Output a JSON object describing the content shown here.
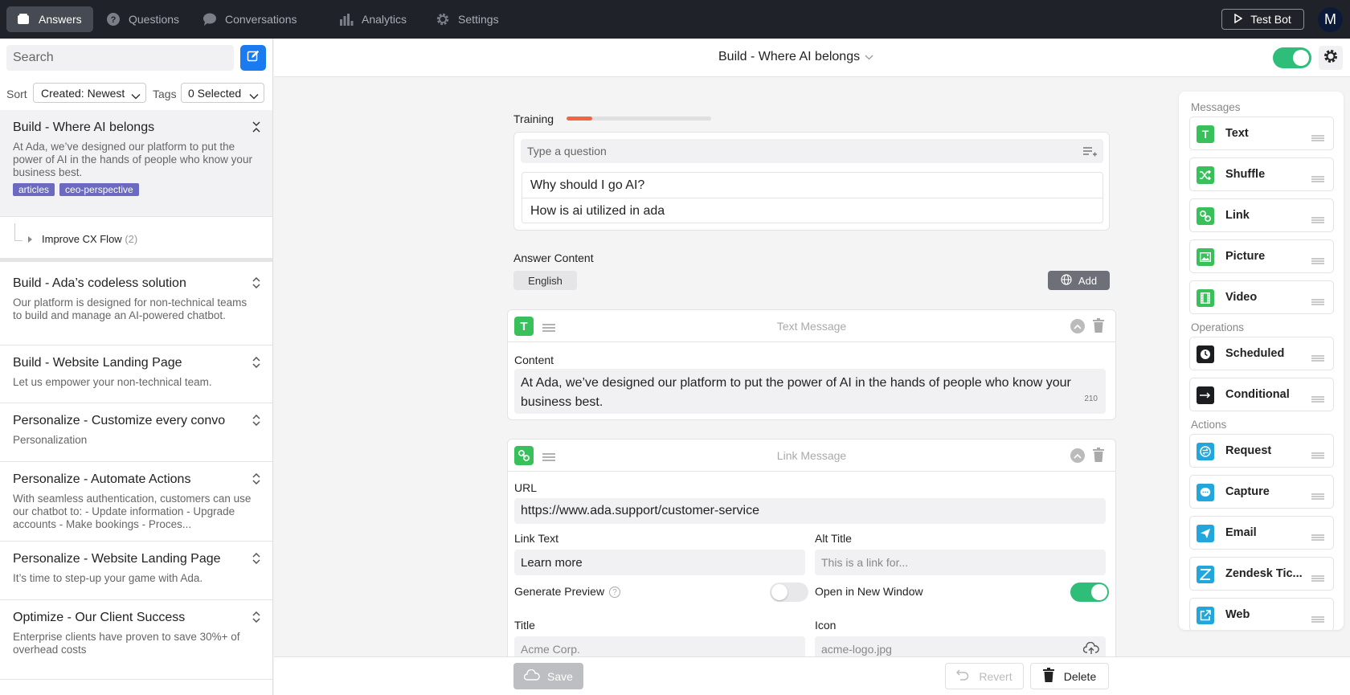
{
  "nav": {
    "tabs": [
      {
        "label": "Answers",
        "icon": "stack-icon",
        "active": true
      },
      {
        "label": "Questions",
        "icon": "question-icon",
        "active": false
      },
      {
        "label": "Conversations",
        "icon": "chat-bubble-icon",
        "active": false
      },
      {
        "label": "Analytics",
        "icon": "bar-chart-icon",
        "active": false
      },
      {
        "label": "Settings",
        "icon": "gear-icon",
        "active": false
      }
    ],
    "test_bot_label": "Test Bot",
    "avatar_initial": "M"
  },
  "sidebar": {
    "search_placeholder": "Search",
    "sort_label": "Sort",
    "sort_value": "Created: Newest",
    "tags_label": "Tags",
    "tags_value": "0 Selected",
    "answers": [
      {
        "title": "Build - Where AI belongs",
        "desc": "At Ada, we’ve designed our platform to put the power of AI in the hands of people who know your business best.",
        "tags": [
          "articles",
          "ceo-perspective"
        ],
        "selected": true
      },
      {
        "title": "Build - Ada’s codeless solution",
        "desc": "Our platform is designed for non-technical teams to build and manage an AI-powered chatbot."
      },
      {
        "title": "Build - Website Landing Page",
        "desc": "Let us empower your non-technical team."
      },
      {
        "title": "Personalize - Customize every convo",
        "desc": "Personalization"
      },
      {
        "title": "Personalize - Automate Actions",
        "desc": "With seamless authentication, customers can use our chatbot to: - Update information - Upgrade accounts - Make bookings - Proces..."
      },
      {
        "title": "Personalize - Website Landing Page",
        "desc": "It’s time to step-up your game with Ada."
      },
      {
        "title": "Optimize - Our Client Success",
        "desc": "Enterprise clients have proven to save 30%+ of overhead costs"
      }
    ],
    "subflow": {
      "label": "Improve CX Flow",
      "count": "(2)"
    }
  },
  "editor": {
    "title": "Build - Where AI belongs",
    "enabled": true,
    "training_label": "Training",
    "training_progress": 0.18,
    "question_placeholder": "Type a question",
    "questions": [
      "Why should I go AI?",
      "How is ai utilized in ada"
    ],
    "answer_content_label": "Answer Content",
    "language": "English",
    "add_label": "Add",
    "text_block": {
      "title": "Text Message",
      "content_label": "Content",
      "content": "At Ada, we’ve designed our platform to put the power of AI in the hands of people who know your business best.",
      "char_count": "210"
    },
    "link_block": {
      "title": "Link Message",
      "url_label": "URL",
      "url": "https://www.ada.support/customer-service",
      "link_text_label": "Link Text",
      "link_text": "Learn more",
      "alt_title_label": "Alt Title",
      "alt_title_placeholder": "This is a link for...",
      "generate_preview_label": "Generate Preview",
      "generate_preview": false,
      "open_new_window_label": "Open in New Window",
      "open_new_window": true,
      "title_label": "Title",
      "title_placeholder": "Acme Corp.",
      "icon_label": "Icon",
      "icon_placeholder": "acme-logo.jpg"
    },
    "save_label": "Save",
    "revert_label": "Revert",
    "delete_label": "Delete"
  },
  "palette": {
    "sections": [
      {
        "label": "Messages",
        "items": [
          {
            "label": "Text",
            "icon": "text-icon",
            "color": "#38c15a"
          },
          {
            "label": "Shuffle",
            "icon": "shuffle-icon",
            "color": "#38c15a"
          },
          {
            "label": "Link",
            "icon": "link-icon",
            "color": "#38c15a"
          },
          {
            "label": "Picture",
            "icon": "picture-icon",
            "color": "#38c15a"
          },
          {
            "label": "Video",
            "icon": "video-icon",
            "color": "#38c15a"
          }
        ]
      },
      {
        "label": "Operations",
        "items": [
          {
            "label": "Scheduled",
            "icon": "clock-icon",
            "color": "#1c1d20"
          },
          {
            "label": "Conditional",
            "icon": "conditional-icon",
            "color": "#1c1d20"
          }
        ]
      },
      {
        "label": "Actions",
        "items": [
          {
            "label": "Request",
            "icon": "request-icon",
            "color": "#23a6dc"
          },
          {
            "label": "Capture",
            "icon": "capture-icon",
            "color": "#23a6dc"
          },
          {
            "label": "Email",
            "icon": "email-icon",
            "color": "#23a6dc"
          },
          {
            "label": "Zendesk Tic...",
            "icon": "zendesk-icon",
            "color": "#23a6dc"
          },
          {
            "label": "Web",
            "icon": "web-icon",
            "color": "#23a6dc"
          }
        ]
      }
    ]
  },
  "colors": {
    "nav_bg": "#1f2228",
    "accent_blue": "#1a7af0",
    "toggle_green": "#2fbe7a",
    "message_green": "#38c15a",
    "action_blue": "#23a6dc",
    "training_orange": "#f2663f",
    "tag_purple": "#6b6ac0"
  }
}
